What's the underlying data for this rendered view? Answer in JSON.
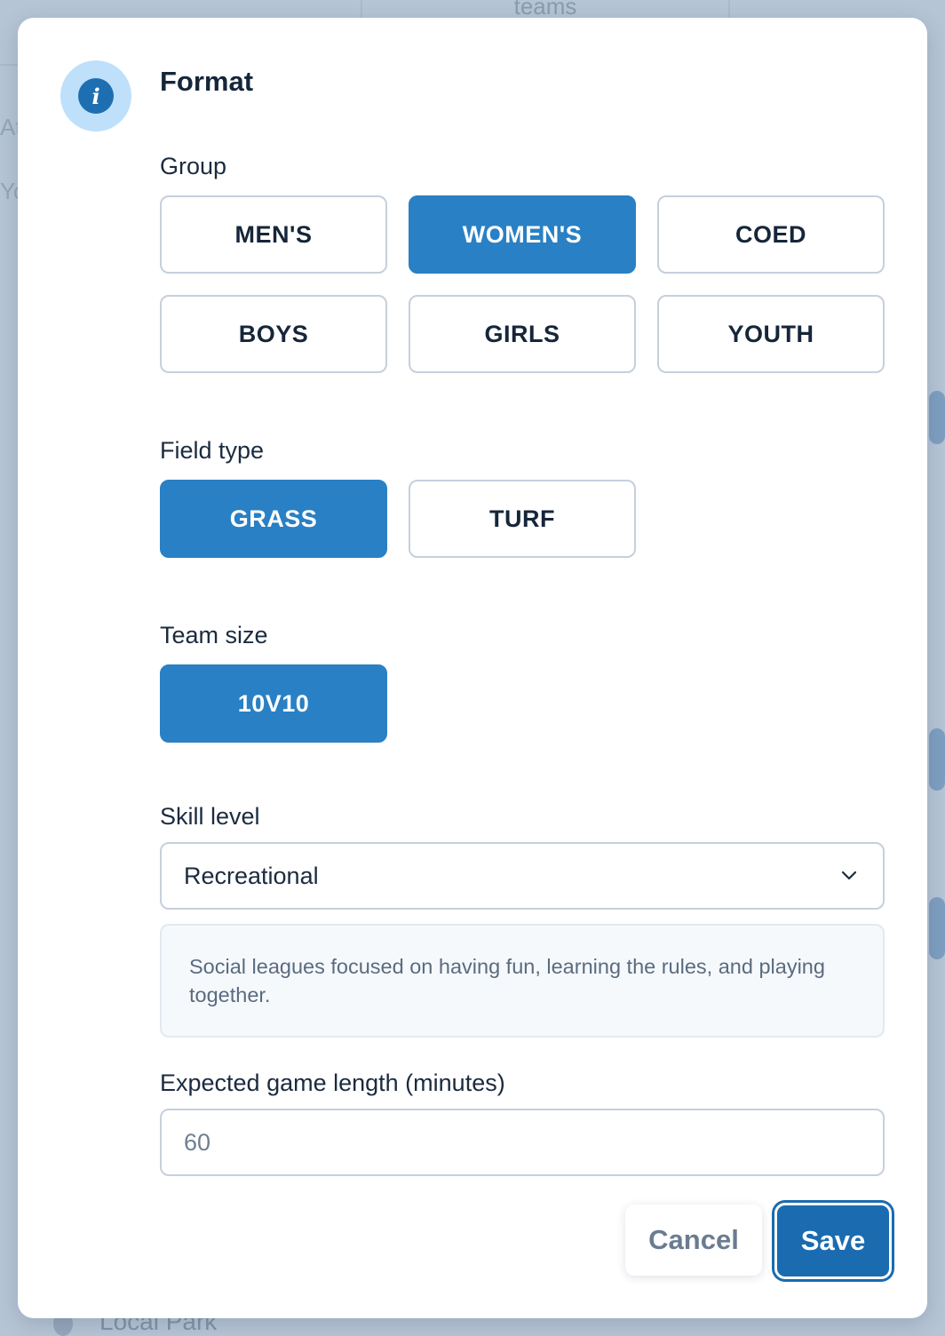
{
  "background": {
    "tab_label": "teams",
    "ghost_a": "At",
    "ghost_y": "Yo",
    "footer_location": "Local Park"
  },
  "modal": {
    "icon": "info-icon",
    "icon_glyph": "i",
    "title": "Format"
  },
  "group": {
    "label": "Group",
    "options": [
      "MEN'S",
      "WOMEN'S",
      "COED",
      "BOYS",
      "GIRLS",
      "YOUTH"
    ],
    "selected": "WOMEN'S"
  },
  "field_type": {
    "label": "Field type",
    "options": [
      "GRASS",
      "TURF"
    ],
    "selected": "GRASS"
  },
  "team_size": {
    "label": "Team size",
    "options": [
      "10V10"
    ],
    "selected": "10V10"
  },
  "skill_level": {
    "label": "Skill level",
    "value": "Recreational",
    "description": "Social leagues focused on having fun, learning the rules, and playing together."
  },
  "game_length": {
    "label": "Expected game length (minutes)",
    "placeholder": "60"
  },
  "actions": {
    "cancel_label": "Cancel",
    "save_label": "Save"
  },
  "colors": {
    "accent": "#2980c4",
    "save": "#1a6bb0",
    "badge_bg": "#bfe0fb"
  }
}
